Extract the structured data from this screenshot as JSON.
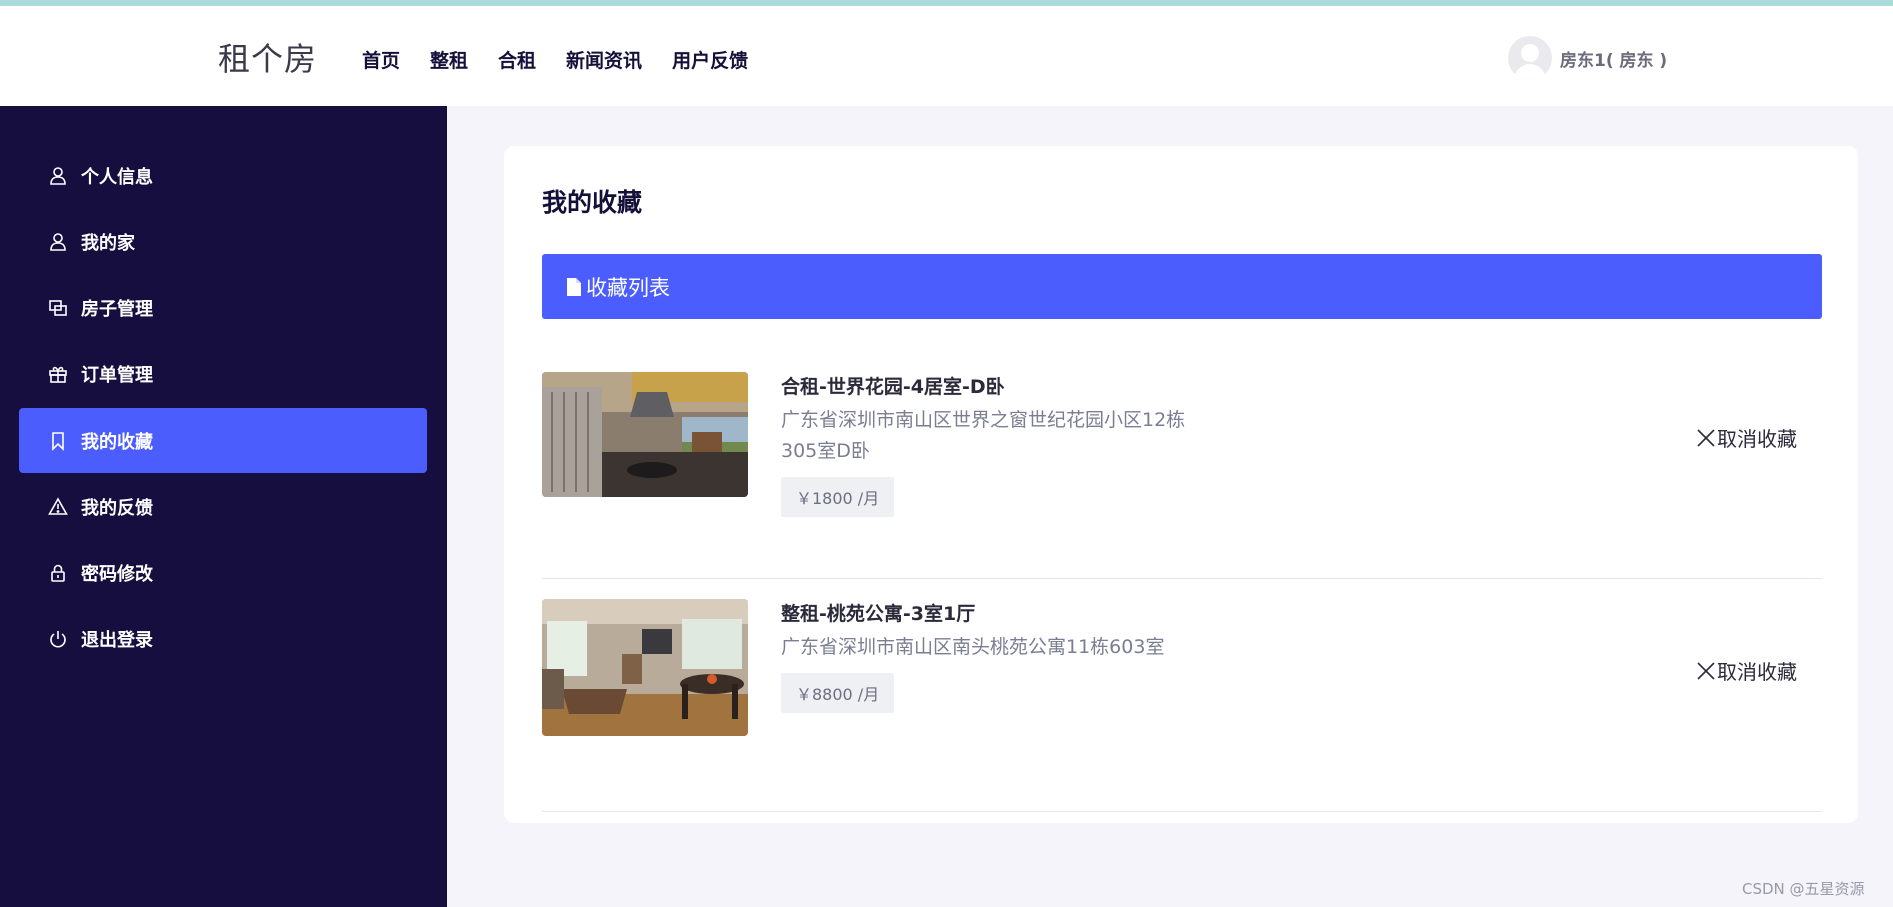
{
  "brand": {
    "logo": "租个房"
  },
  "nav": [
    {
      "label": "首页"
    },
    {
      "label": "整租"
    },
    {
      "label": "合租"
    },
    {
      "label": "新闻资讯"
    },
    {
      "label": "用户反馈"
    }
  ],
  "user": {
    "name": "房东1( 房东 )",
    "avatar_icon": "user-avatar-icon"
  },
  "sidebar": {
    "items": [
      {
        "label": "个人信息",
        "icon": "user-icon",
        "active": false
      },
      {
        "label": "我的家",
        "icon": "user-icon",
        "active": false
      },
      {
        "label": "房子管理",
        "icon": "copy-icon",
        "active": false
      },
      {
        "label": "订单管理",
        "icon": "gift-icon",
        "active": false
      },
      {
        "label": "我的收藏",
        "icon": "bookmark-icon",
        "active": true
      },
      {
        "label": "我的反馈",
        "icon": "warning-icon",
        "active": false
      },
      {
        "label": "密码修改",
        "icon": "lock-icon",
        "active": false
      },
      {
        "label": "退出登录",
        "icon": "power-icon",
        "active": false
      }
    ]
  },
  "main": {
    "title": "我的收藏",
    "list_header": "收藏列表",
    "favorites": [
      {
        "title": "合租-世界花园-4居室-D卧",
        "address": "广东省深圳市南山区世界之窗世纪花园小区12栋305室D卧",
        "price": "￥1800 /月",
        "action": "取消收藏"
      },
      {
        "title": "整租-桃苑公寓-3室1厅",
        "address": "广东省深圳市南山区南头桃苑公寓11栋603室",
        "price": "￥8800 /月",
        "action": "取消收藏"
      }
    ]
  },
  "watermark": "CSDN @五星资源",
  "colors": {
    "accent": "#4c5dfd",
    "sidebar_bg": "#150e3f",
    "top_strip": "#a9dcd9"
  }
}
